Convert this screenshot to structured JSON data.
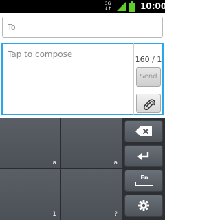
{
  "status_bar": {
    "network_type": "3G",
    "network_sub": "↓↑",
    "signal_icon": "signal-bars-icon",
    "battery_icon": "battery-icon",
    "time": "10:00"
  },
  "compose": {
    "to_placeholder": "To",
    "message_placeholder": "Tap to compose",
    "counter": "160 / 1",
    "send_label": "Send",
    "attach_icon": "paperclip-icon"
  },
  "keyboard": {
    "keys": [
      {
        "label": "a"
      },
      {
        "label": "a"
      },
      {
        "label": "1"
      },
      {
        "label": "?"
      }
    ],
    "language_label": "En",
    "function_keys": [
      "backspace-icon",
      "enter-icon",
      "language-space-icon",
      "settings-gear-icon"
    ]
  },
  "colors": {
    "focus_border": "#2aa7ea",
    "keyboard_bg": "#2d2f33",
    "key_bg": "#555a61",
    "status_bar_bg": "#000000"
  }
}
